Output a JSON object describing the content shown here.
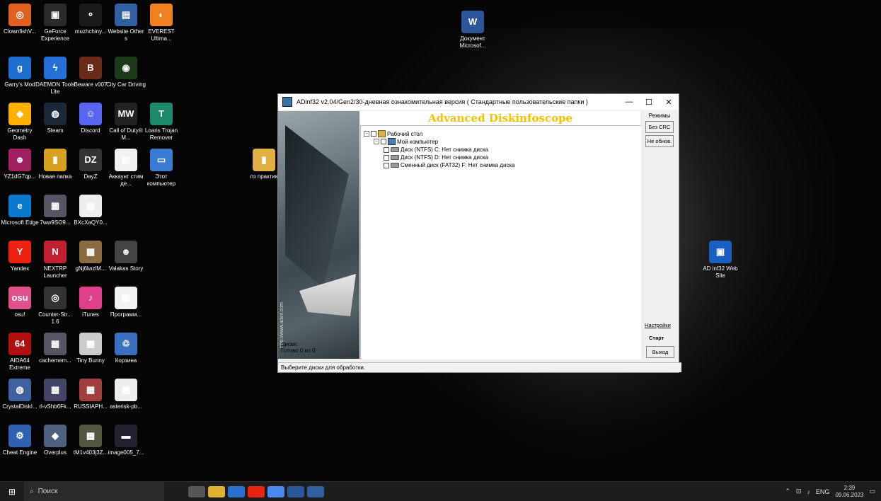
{
  "desktop_icons": [
    {
      "label": "ClownfishV...",
      "color": "#e06020",
      "glyph": "◎"
    },
    {
      "label": "GeForce Experience",
      "color": "#2a2a2a",
      "glyph": "▣"
    },
    {
      "label": "muzhchiny...",
      "color": "#1a1a1a",
      "glyph": "⚬"
    },
    {
      "label": "Website Other s",
      "color": "#3060a0",
      "glyph": "▤"
    },
    {
      "label": "EVEREST Ultima...",
      "color": "#f08020",
      "glyph": "◐"
    },
    {
      "label": "Документ Microsof...",
      "color": "#2b579a",
      "glyph": "W"
    },
    {
      "label": "Garry's Mod",
      "color": "#1e6fd0",
      "glyph": "g"
    },
    {
      "label": "DAEMON Tools Lite",
      "color": "#2470d8",
      "glyph": "ϟ"
    },
    {
      "label": "Beware v007",
      "color": "#6a2a1a",
      "glyph": "B"
    },
    {
      "label": "City Car Driving",
      "color": "#1a3a1a",
      "glyph": "◉"
    },
    {
      "label": "Geometry Dash",
      "color": "#ffb000",
      "glyph": "◆"
    },
    {
      "label": "Steam",
      "color": "#1b2838",
      "glyph": "◍"
    },
    {
      "label": "Discord",
      "color": "#5865f2",
      "glyph": "☺"
    },
    {
      "label": "Call of Duty® M...",
      "color": "#222",
      "glyph": "MW"
    },
    {
      "label": "Loaris Trojan Remover",
      "color": "#1a8a6a",
      "glyph": "T"
    },
    {
      "label": "YZ1dG7qp...",
      "color": "#a02060",
      "glyph": "☻"
    },
    {
      "label": "Новая папка",
      "color": "#d8a020",
      "glyph": "▮"
    },
    {
      "label": "DayZ",
      "color": "#333",
      "glyph": "DZ"
    },
    {
      "label": "Аккаунт стим де...",
      "color": "#f2f2f2",
      "glyph": "▤"
    },
    {
      "label": "Этот компьютер",
      "color": "#3a7ad0",
      "glyph": "▭"
    },
    {
      "label": "пз практик",
      "color": "#e0b040",
      "glyph": "▮"
    },
    {
      "label": "Microsoft Edge",
      "color": "#0a7ad0",
      "glyph": "e"
    },
    {
      "label": "7ww9SO9...",
      "color": "#556",
      "glyph": "▦"
    },
    {
      "label": "BXcXaQY0...",
      "color": "#eee",
      "glyph": "▤"
    },
    {
      "label": "Yandex",
      "color": "#e21",
      "glyph": "Y"
    },
    {
      "label": "NEXTRP Launcher",
      "color": "#c02030",
      "glyph": "N"
    },
    {
      "label": "gNj6lwzlM...",
      "color": "#8a6a40",
      "glyph": "▦"
    },
    {
      "label": "Valakas Story",
      "color": "#444",
      "glyph": "☻"
    },
    {
      "label": "AD inf32 Web Site",
      "color": "#1a60c0",
      "glyph": "▣"
    },
    {
      "label": "osu!",
      "color": "#e0508a",
      "glyph": "osu"
    },
    {
      "label": "Counter-Str... 1.6",
      "color": "#333",
      "glyph": "◎"
    },
    {
      "label": "iTunes",
      "color": "#e0408a",
      "glyph": "♪"
    },
    {
      "label": "Программ...",
      "color": "#f2f2f2",
      "glyph": "▤"
    },
    {
      "label": "AIDA64 Extreme",
      "color": "#b01010",
      "glyph": "64"
    },
    {
      "label": "cachemem...",
      "color": "#556",
      "glyph": "▦"
    },
    {
      "label": "Tiny Bunny",
      "color": "#ccc",
      "glyph": "▦"
    },
    {
      "label": "Корзина",
      "color": "#3a70c0",
      "glyph": "♲"
    },
    {
      "label": "CrystalDiskI...",
      "color": "#4060a0",
      "glyph": "◍"
    },
    {
      "label": "rl-vShb6Fk...",
      "color": "#446",
      "glyph": "▦"
    },
    {
      "label": "RUSSIAPH...",
      "color": "#a04040",
      "glyph": "▦"
    },
    {
      "label": "asterisk-pb...",
      "color": "#eee",
      "glyph": "▦"
    },
    {
      "label": "Cheat Engine",
      "color": "#3060b0",
      "glyph": "⚙"
    },
    {
      "label": "Overplus",
      "color": "#506080",
      "glyph": "◆"
    },
    {
      "label": "tM1v403j3Z...",
      "color": "#554",
      "glyph": "▦"
    },
    {
      "label": "image005_7...",
      "color": "#223",
      "glyph": "▬"
    }
  ],
  "window": {
    "title": "ADinf32 v2.04/Gen2/30-дневная ознакомительная версия ( Стандартные пользовательские папки )",
    "minimize": "—",
    "maximize": "☐",
    "close": "✕",
    "banner": "Advanced Diskinfoscope",
    "watermark": "http://www.adinf.com",
    "tree": {
      "desktop": "Рабочий стол",
      "computer": "Мой компьютер",
      "disk_c": "Диск (NTFS)  C:  Нет снимка диска",
      "disk_d": "Диск (NTFS)  D:  Нет снимка диска",
      "disk_f": "Сменный диск (FAT32) F:  Нет снимка диска"
    },
    "side": {
      "modes": "Режимы",
      "no_crc": "Без CRC",
      "no_update": "Не обнов.",
      "settings": "Настройки",
      "start": "Старт",
      "exit": "Выход"
    },
    "disks_label": "Диски:",
    "disks_status": "Готово 0 из 0",
    "statusbar": "Выберите диски для обработки."
  },
  "taskbar": {
    "start_icon": "windows-start-icon",
    "search_placeholder": "Поиск",
    "tray_lang": "ENG",
    "time": "2:39",
    "date": "09.06.2023",
    "apps": [
      {
        "name": "task-view",
        "color": "#555"
      },
      {
        "name": "file-explorer",
        "color": "#e0b030"
      },
      {
        "name": "store",
        "color": "#2a70d0"
      },
      {
        "name": "yandex",
        "color": "#e21"
      },
      {
        "name": "chrome",
        "color": "#4a8af0"
      },
      {
        "name": "word",
        "color": "#2b579a"
      },
      {
        "name": "adinf",
        "color": "#3060a0"
      }
    ]
  }
}
